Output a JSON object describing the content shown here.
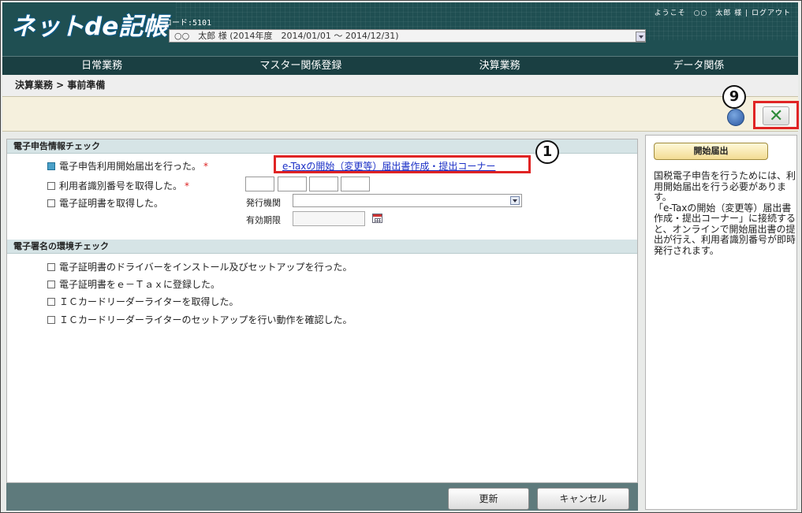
{
  "header": {
    "logo_text": "ネットde記帳",
    "code_label": "コード:5101",
    "company_info": "○○　太郎 様 (2014年度　2014/01/01 ～ 2014/12/31)",
    "user_links": "ようこそ　○○　太郎 様 | ログアウト"
  },
  "menu": {
    "items": [
      {
        "label": "日常業務"
      },
      {
        "label": "マスター関係登録"
      },
      {
        "label": "決算業務"
      },
      {
        "label": "データ関係"
      }
    ]
  },
  "breadcrumb": "決算業務 > 事前準備",
  "toolbar": {
    "help_icon": "question-icon",
    "close_icon": "x-icon",
    "callout_9": "9"
  },
  "sections": {
    "efiling_check": {
      "title": "電子申告情報チェック",
      "items": [
        {
          "label": "電子申告利用開始届出を行った。",
          "required": "*",
          "checked": true
        },
        {
          "label": "利用者識別番号を取得した。",
          "required": "*",
          "checked": false
        },
        {
          "label": "電子証明書を取得した。",
          "checked": false
        }
      ],
      "etax_link": "e-Taxの開始（変更等）届出書作成・提出コーナー",
      "callout_1": "1",
      "issuer_label": "発行機関",
      "issuer_value": "",
      "expiry_label": "有効期限",
      "expiry_value": ""
    },
    "signature_check": {
      "title": "電子署名の環境チェック",
      "items": [
        {
          "label": "電子証明書のドライバーをインストール及びセットアップを行った。",
          "checked": false
        },
        {
          "label": "電子証明書をｅ－Ｔａｘに登録した。",
          "checked": false
        },
        {
          "label": "ＩＣカードリーダーライターを取得した。",
          "checked": false
        },
        {
          "label": "ＩＣカードリーダーライターのセットアップを行い動作を確認した。",
          "checked": false
        }
      ]
    }
  },
  "footer": {
    "update_label": "更新",
    "cancel_label": "キャンセル"
  },
  "side_panel": {
    "title": "開始届出",
    "text": "国税電子申告を行うためには、利用開始届出を行う必要があります。\n「e-Taxの開始（変更等）届出書作成・提出コーナー」に接続すると、オンラインで開始届出書の提出が行え、利用者識別番号が即時発行されます。"
  },
  "colors": {
    "header_bg": "#1f4f52",
    "highlight_red": "#e02424",
    "link_blue": "#1a2fc6",
    "checked_blue": "#4aa0c8"
  }
}
